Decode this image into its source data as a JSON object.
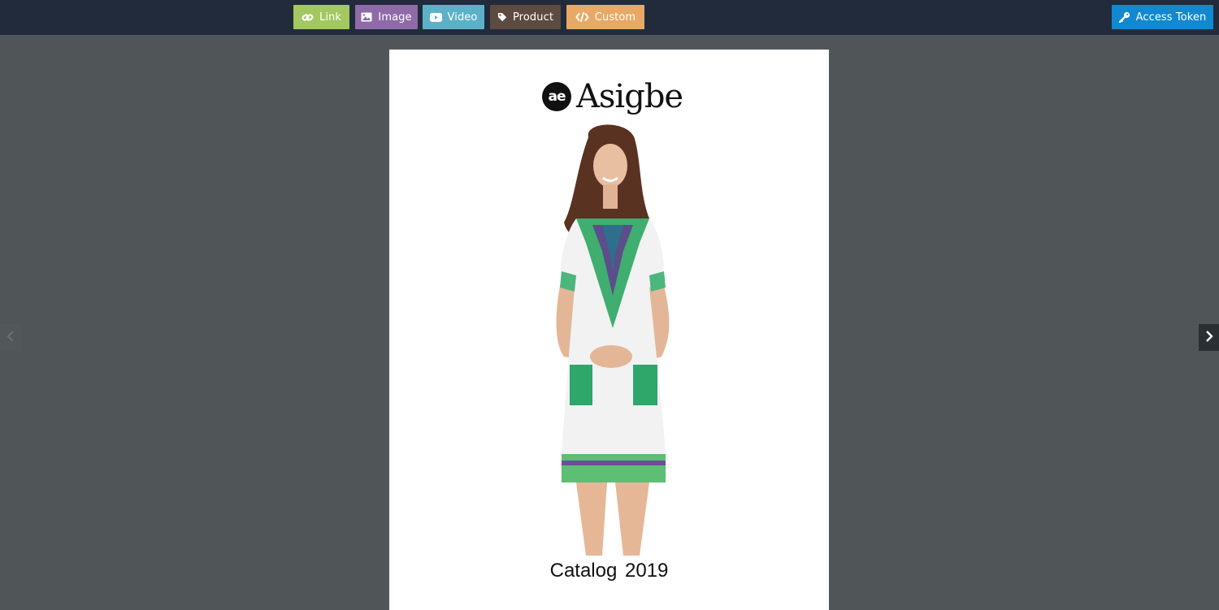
{
  "toolbar": {
    "buttons": [
      {
        "label": "Link",
        "icon": "link-icon",
        "color": "#a3c761"
      },
      {
        "label": "Image",
        "icon": "image-icon",
        "color": "#8e6ba8"
      },
      {
        "label": "Video",
        "icon": "video-icon",
        "color": "#5cb1c8"
      },
      {
        "label": "Product",
        "icon": "tag-icon",
        "color": "#5d4a40"
      },
      {
        "label": "Custom",
        "icon": "code-icon",
        "color": "#e7a965"
      }
    ],
    "access_token": {
      "label": "Access Token",
      "icon": "key-icon",
      "color": "#1188d0"
    }
  },
  "page": {
    "logo_mark": "ae",
    "logo_text": "Asigbe",
    "caption": "Catalog  2019"
  },
  "navigation": {
    "prev_icon": "chevron-left-icon",
    "next_icon": "chevron-right-icon"
  },
  "colors": {
    "topbar": "#212b3b",
    "background": "#505558"
  }
}
